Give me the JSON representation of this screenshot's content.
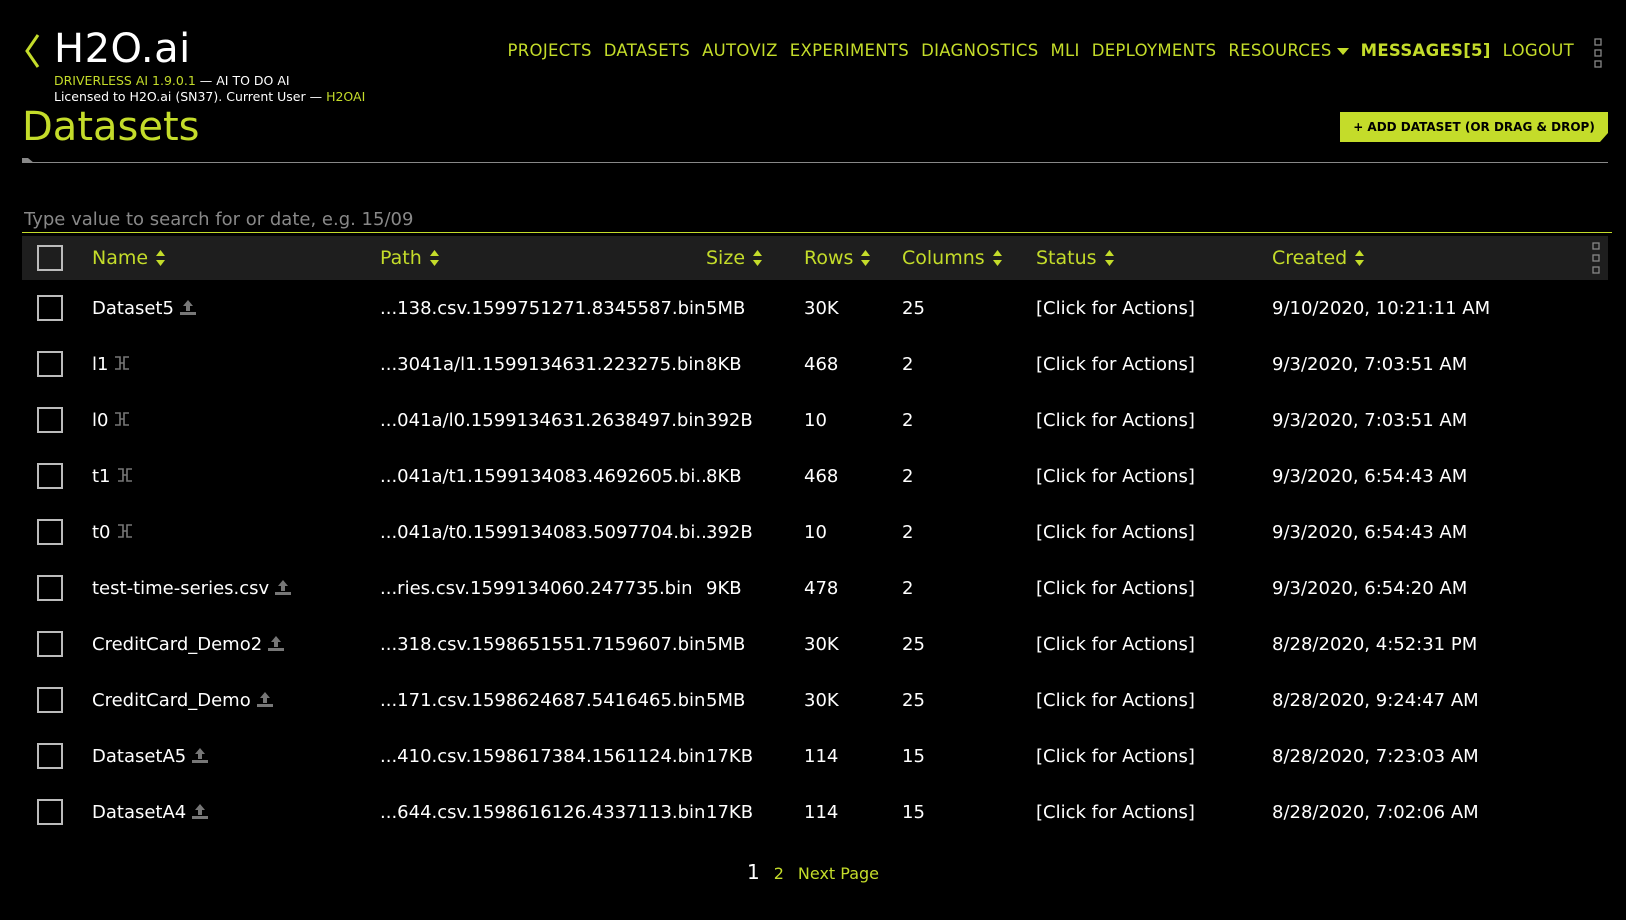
{
  "app": {
    "logo": "H2O.ai",
    "version_product": "DRIVERLESS AI 1.9.0.1",
    "version_tagline": " — AI TO DO AI",
    "license_prefix": "Licensed to H2O.ai (SN37). Current User — ",
    "current_user": "H2OAI"
  },
  "nav": {
    "projects": "PROJECTS",
    "datasets": "DATASETS",
    "autoviz": "AUTOVIZ",
    "experiments": "EXPERIMENTS",
    "diagnostics": "DIAGNOSTICS",
    "mli": "MLI",
    "deployments": "DEPLOYMENTS",
    "resources": "RESOURCES",
    "messages": "MESSAGES[5]",
    "logout": "LOGOUT"
  },
  "page": {
    "title": "Datasets",
    "add_button": "+ ADD DATASET (OR DRAG & DROP)",
    "search_placeholder": "Type value to search for or date, e.g. 15/09"
  },
  "table": {
    "headers": {
      "name": "Name",
      "path": "Path",
      "size": "Size",
      "rows": "Rows",
      "columns": "Columns",
      "status": "Status",
      "created": "Created"
    },
    "rows": [
      {
        "name": "Dataset5",
        "icon": "upload-icon",
        "path": "...138.csv.1599751271.8345587.bin",
        "size": "5MB",
        "rows": "30K",
        "columns": "25",
        "status": "[Click for Actions]",
        "created": "9/10/2020, 10:21:11 AM"
      },
      {
        "name": "l1",
        "icon": "split-icon",
        "path": "...3041a/l1.1599134631.223275.bin",
        "size": "8KB",
        "rows": "468",
        "columns": "2",
        "status": "[Click for Actions]",
        "created": "9/3/2020, 7:03:51 AM"
      },
      {
        "name": "l0",
        "icon": "split-icon",
        "path": "...041a/l0.1599134631.2638497.bin",
        "size": "392B",
        "rows": "10",
        "columns": "2",
        "status": "[Click for Actions]",
        "created": "9/3/2020, 7:03:51 AM"
      },
      {
        "name": "t1",
        "icon": "split-icon",
        "path": "...041a/t1.1599134083.4692605.bi...",
        "size": "8KB",
        "rows": "468",
        "columns": "2",
        "status": "[Click for Actions]",
        "created": "9/3/2020, 6:54:43 AM"
      },
      {
        "name": "t0",
        "icon": "split-icon",
        "path": "...041a/t0.1599134083.5097704.bi...",
        "size": "392B",
        "rows": "10",
        "columns": "2",
        "status": "[Click for Actions]",
        "created": "9/3/2020, 6:54:43 AM"
      },
      {
        "name": "test-time-series.csv",
        "icon": "upload-icon",
        "path": "...ries.csv.1599134060.247735.bin",
        "size": "9KB",
        "rows": "478",
        "columns": "2",
        "status": "[Click for Actions]",
        "created": "9/3/2020, 6:54:20 AM"
      },
      {
        "name": "CreditCard_Demo2",
        "icon": "upload-icon",
        "path": "...318.csv.1598651551.7159607.bin",
        "size": "5MB",
        "rows": "30K",
        "columns": "25",
        "status": "[Click for Actions]",
        "created": "8/28/2020, 4:52:31 PM"
      },
      {
        "name": "CreditCard_Demo",
        "icon": "upload-icon",
        "path": "...171.csv.1598624687.5416465.bin",
        "size": "5MB",
        "rows": "30K",
        "columns": "25",
        "status": "[Click for Actions]",
        "created": "8/28/2020, 9:24:47 AM"
      },
      {
        "name": "DatasetA5",
        "icon": "upload-icon",
        "path": "...410.csv.1598617384.1561124.bin",
        "size": "17KB",
        "rows": "114",
        "columns": "15",
        "status": "[Click for Actions]",
        "created": "8/28/2020, 7:23:03 AM"
      },
      {
        "name": "DatasetA4",
        "icon": "upload-icon",
        "path": "...644.csv.1598616126.4337113.bin",
        "size": "17KB",
        "rows": "114",
        "columns": "15",
        "status": "[Click for Actions]",
        "created": "8/28/2020, 7:02:06 AM"
      }
    ]
  },
  "pagination": {
    "current": "1",
    "next_num": "2",
    "next_label": "Next Page"
  },
  "colors": {
    "accent": "#c4dc2a",
    "background": "#000000",
    "header_bg": "#1e1e1e"
  }
}
